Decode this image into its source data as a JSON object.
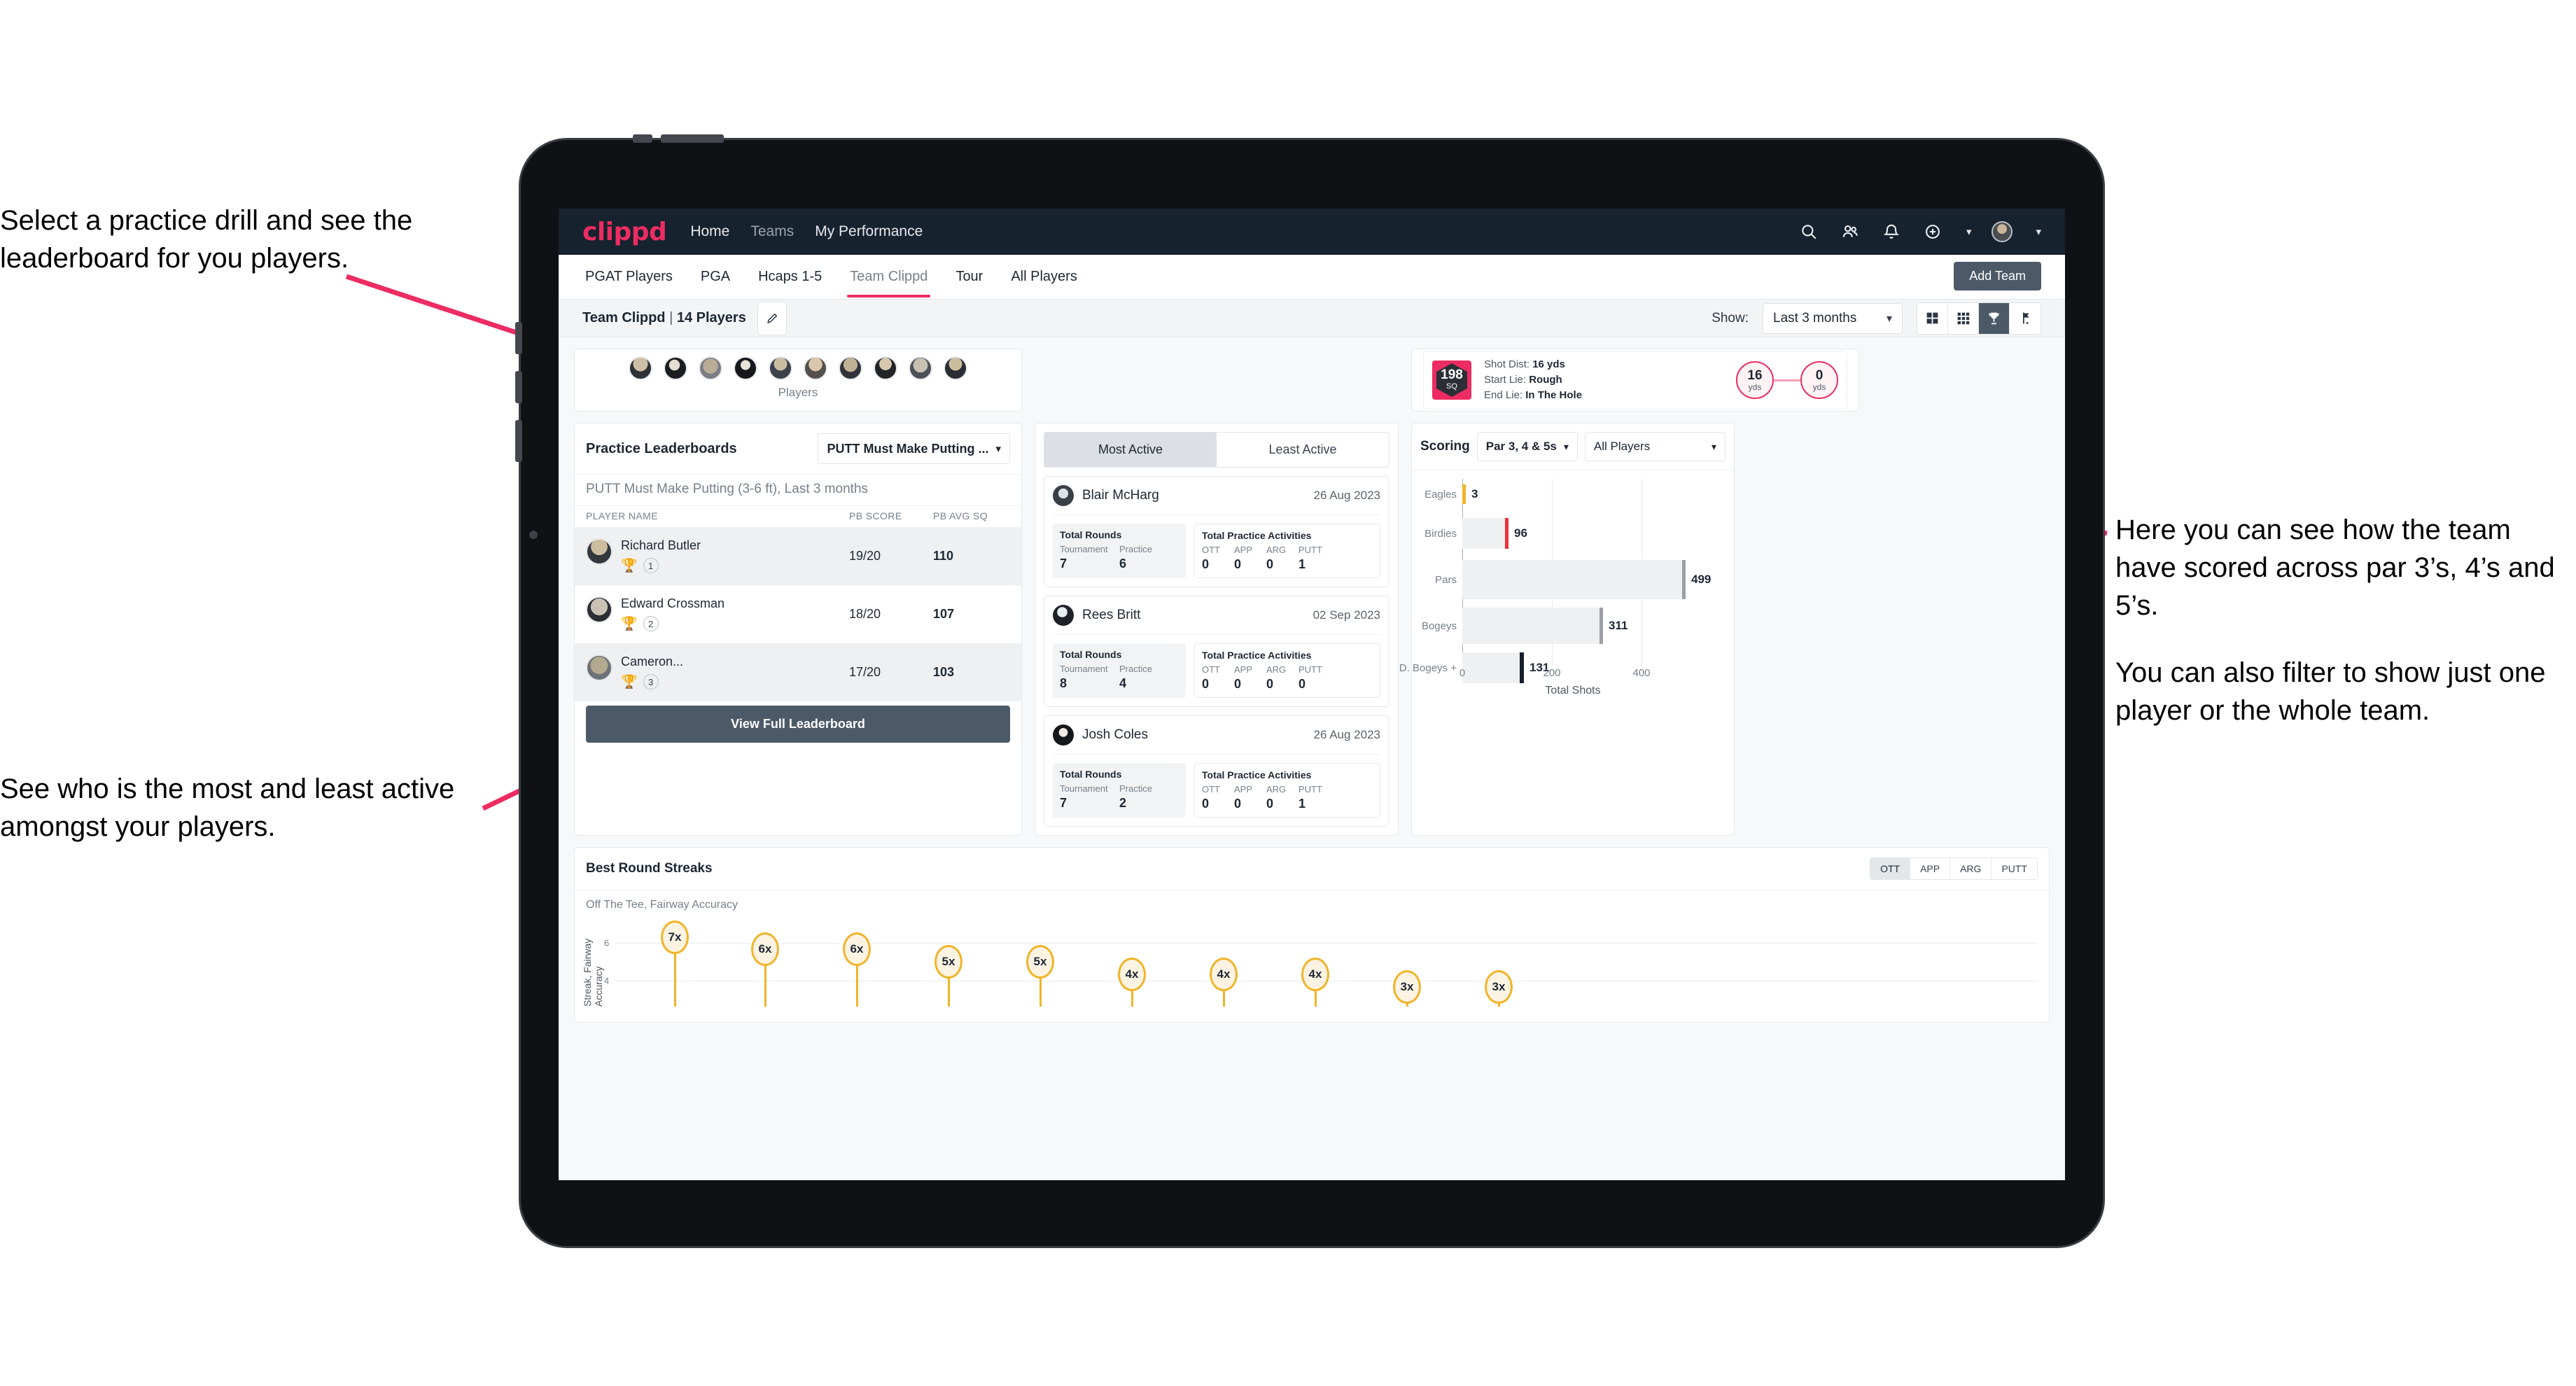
{
  "annotations": {
    "top_left": "Select a practice drill and see the leaderboard for you players.",
    "bottom_left": "See who is the most and least active amongst your players.",
    "right_1": "Here you can see how the team have scored across par 3’s, 4’s and 5’s.",
    "right_2": "You can also filter to show just one player or the whole team."
  },
  "accent_color": "#ec2c62",
  "header": {
    "logo": "clippd",
    "nav": [
      {
        "label": "Home",
        "active": true
      },
      {
        "label": "Teams",
        "active": false
      },
      {
        "label": "My Performance",
        "active": true
      }
    ],
    "icons": [
      "search-icon",
      "people-icon",
      "bell-icon",
      "plus-circle-icon",
      "avatar"
    ]
  },
  "tabs": {
    "items": [
      "PGAT Players",
      "PGA",
      "Hcaps 1-5",
      "Team Clippd",
      "Tour",
      "All Players"
    ],
    "active": "Team Clippd",
    "add_team_label": "Add Team"
  },
  "team_strip": {
    "name": "Team Clippd",
    "separator": " | ",
    "player_count": "14 Players",
    "edit_icon": "pencil-icon",
    "show_label": "Show:",
    "range_value": "Last 3 months",
    "view_toggles": [
      "grid-large-icon",
      "grid-small-icon",
      "trophy-icon",
      "flag-icon"
    ],
    "view_selected": "trophy-icon"
  },
  "players_card": {
    "caption": "Players",
    "avatar_count": 10
  },
  "shot_card": {
    "sq_value": "198",
    "sq_label": "SQ",
    "lines": [
      {
        "label": "Shot Dist:",
        "value": "16 yds"
      },
      {
        "label": "Start Lie:",
        "value": "Rough"
      },
      {
        "label": "End Lie:",
        "value": "In The Hole"
      }
    ],
    "start_yards": "16",
    "start_unit": "yds",
    "end_yards": "0",
    "end_unit": "yds"
  },
  "leaderboard": {
    "title": "Practice Leaderboards",
    "drill_select": "PUTT Must Make Putting ...",
    "subtitle_bold": "PUTT Must Make Putting (3-6 ft),",
    "subtitle_light": " Last 3 months",
    "columns": [
      "PLAYER NAME",
      "PB SCORE",
      "PB AVG SQ"
    ],
    "rows": [
      {
        "name": "Richard Butler",
        "rank": "1",
        "trophy": "gold",
        "score": "19/20",
        "sq": "110"
      },
      {
        "name": "Edward Crossman",
        "rank": "2",
        "trophy": "silver",
        "score": "18/20",
        "sq": "107"
      },
      {
        "name": "Cameron...",
        "rank": "3",
        "trophy": "bronze",
        "score": "17/20",
        "sq": "103"
      }
    ],
    "button": "View Full Leaderboard"
  },
  "activity": {
    "tabs": [
      "Most Active",
      "Least Active"
    ],
    "active_tab": "Most Active",
    "rounds_title": "Total Rounds",
    "rounds_cols": [
      "Tournament",
      "Practice"
    ],
    "practice_title": "Total Practice Activities",
    "practice_cols": [
      "OTT",
      "APP",
      "ARG",
      "PUTT"
    ],
    "cards": [
      {
        "name": "Blair McHarg",
        "date": "26 Aug 2023",
        "tournament": "7",
        "practice": "6",
        "ott": "0",
        "app": "0",
        "arg": "0",
        "putt": "1"
      },
      {
        "name": "Rees Britt",
        "date": "02 Sep 2023",
        "tournament": "8",
        "practice": "4",
        "ott": "0",
        "app": "0",
        "arg": "0",
        "putt": "0"
      },
      {
        "name": "Josh Coles",
        "date": "26 Aug 2023",
        "tournament": "7",
        "practice": "2",
        "ott": "0",
        "app": "0",
        "arg": "0",
        "putt": "1"
      }
    ]
  },
  "scoring": {
    "title": "Scoring",
    "par_select": "Par 3, 4 & 5s",
    "player_select": "All Players"
  },
  "streaks": {
    "title": "Best Round Streaks",
    "segments": [
      "OTT",
      "APP",
      "ARG",
      "PUTT"
    ],
    "segment_selected": "OTT",
    "subtitle_bold": "Off The Tee,",
    "subtitle_light": " Fairway Accuracy"
  },
  "chart_data": [
    {
      "type": "bar",
      "orientation": "horizontal",
      "title": "Scoring",
      "categories": [
        "Eagles",
        "Birdies",
        "Pars",
        "Bogeys",
        "D. Bogeys +"
      ],
      "values": [
        3,
        96,
        499,
        311,
        131
      ],
      "cap_colors": [
        "#f0b429",
        "#e8323c",
        "#9aa0a6",
        "#9aa0a6",
        "#14202b"
      ],
      "xlabel": "Total Shots",
      "ylabel": "",
      "xticks": [
        0,
        200,
        400
      ],
      "xlim": [
        0,
        560
      ],
      "grid": true,
      "legend": false
    },
    {
      "type": "scatter",
      "title": "Best Round Streaks",
      "subtitle": "Off The Tee, Fairway Accuracy",
      "ylabel": "Streak, Fairway Accuracy",
      "yticks": [
        4,
        6
      ],
      "ylim": [
        0,
        8
      ],
      "values": [
        7,
        6,
        6,
        5,
        5,
        4,
        4,
        4,
        3,
        3
      ],
      "labels": [
        "7x",
        "6x",
        "6x",
        "5x",
        "5x",
        "4x",
        "4x",
        "4x",
        "3x",
        "3x"
      ],
      "marker": "lollipop",
      "marker_color": "#f0b429",
      "grid": true,
      "legend": false
    }
  ]
}
